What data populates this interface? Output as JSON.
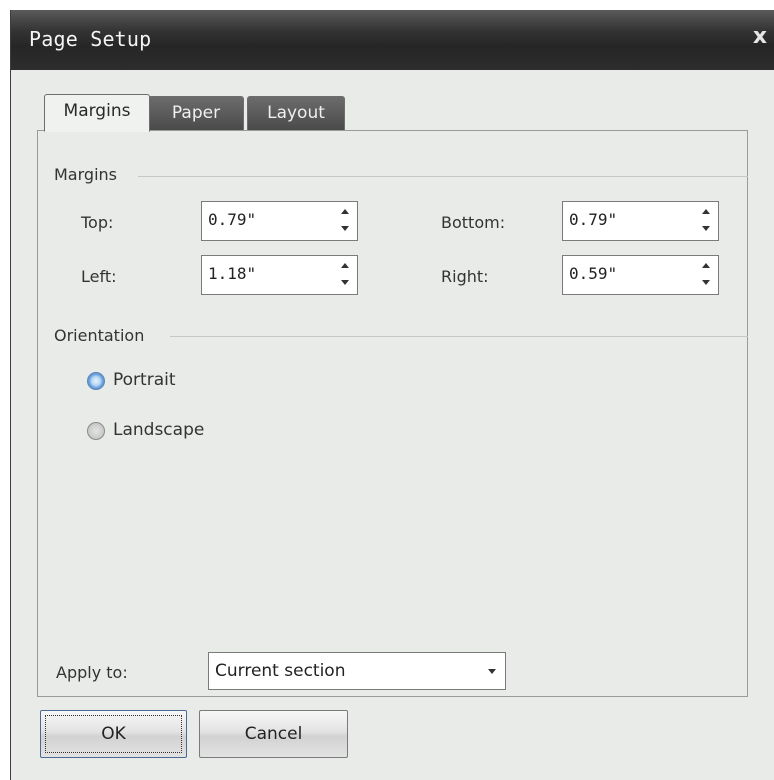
{
  "dialog": {
    "title": "Page Setup",
    "close_glyph": "x"
  },
  "tabs": [
    {
      "label": "Margins",
      "active": true
    },
    {
      "label": "Paper",
      "active": false
    },
    {
      "label": "Layout",
      "active": false
    }
  ],
  "margins": {
    "group_label": "Margins",
    "top": {
      "label": "Top:",
      "value": "0.79\""
    },
    "bottom": {
      "label": "Bottom:",
      "value": "0.79\""
    },
    "left": {
      "label": "Left:",
      "value": "1.18\""
    },
    "right": {
      "label": "Right:",
      "value": "0.59\""
    }
  },
  "orientation": {
    "group_label": "Orientation",
    "options": [
      {
        "label": "Portrait",
        "checked": true
      },
      {
        "label": "Landscape",
        "checked": false
      }
    ]
  },
  "apply_to": {
    "label": "Apply to:",
    "value": "Current section"
  },
  "buttons": {
    "ok": "OK",
    "cancel": "Cancel"
  },
  "icons": {
    "spin": "up-down-arrows-icon",
    "dropdown": "chevron-down-icon",
    "close": "close-icon"
  }
}
